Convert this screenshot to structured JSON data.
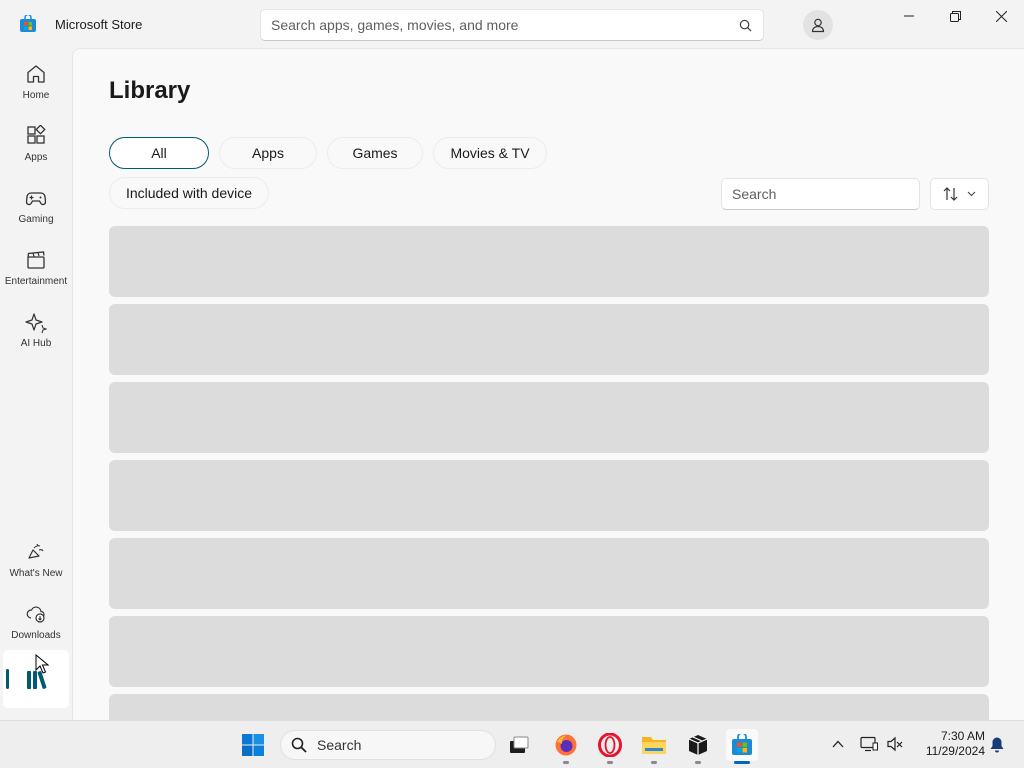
{
  "app": {
    "title": "Microsoft Store",
    "search_placeholder": "Search apps, games, movies, and more"
  },
  "sidebar": {
    "items": [
      {
        "label": "Home",
        "icon": "home-icon"
      },
      {
        "label": "Apps",
        "icon": "apps-icon"
      },
      {
        "label": "Gaming",
        "icon": "gamepad-icon"
      },
      {
        "label": "Entertainment",
        "icon": "clapperboard-icon"
      },
      {
        "label": "AI Hub",
        "icon": "sparkle-icon"
      }
    ],
    "bottom_items": [
      {
        "label": "What's New",
        "icon": "megaphone-icon"
      },
      {
        "label": "Downloads",
        "icon": "cloud-download-icon"
      }
    ],
    "active_item": {
      "icon": "library-icon",
      "label": ""
    }
  },
  "library": {
    "title": "Library",
    "filters": [
      "All",
      "Apps",
      "Games",
      "Movies & TV",
      "Included with device"
    ],
    "selected_filter": "All",
    "search_placeholder": "Search",
    "loading_rows": 7
  },
  "taskbar": {
    "search_label": "Search",
    "time": "7:30 AM",
    "date": "11/29/2024"
  },
  "colors": {
    "accent": "#005a70",
    "skeleton": "#dcdcdc",
    "taskbar_active": "#0067c0"
  }
}
